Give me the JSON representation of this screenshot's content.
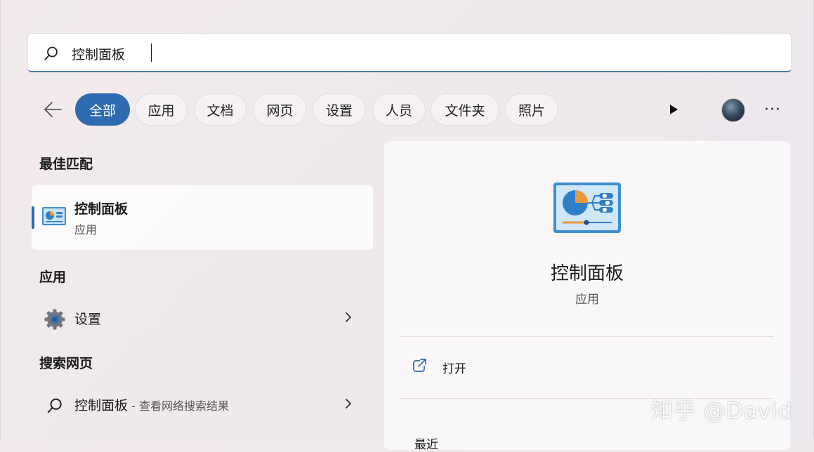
{
  "search": {
    "value": "控制面板",
    "icon": "search-icon"
  },
  "filters": {
    "back_icon": "arrow-left-icon",
    "chips": [
      {
        "label": "全部",
        "active": true
      },
      {
        "label": "应用",
        "active": false
      },
      {
        "label": "文档",
        "active": false
      },
      {
        "label": "网页",
        "active": false
      },
      {
        "label": "设置",
        "active": false
      },
      {
        "label": "人员",
        "active": false
      },
      {
        "label": "文件夹",
        "active": false
      },
      {
        "label": "照片",
        "active": false
      }
    ],
    "play_icon": "play-icon",
    "more_label": "···"
  },
  "results": {
    "best_match_title": "最佳匹配",
    "best_match": {
      "title": "控制面板",
      "subtitle": "应用",
      "icon": "control-panel-icon"
    },
    "apps_title": "应用",
    "apps": [
      {
        "label": "设置",
        "icon": "gear-icon"
      }
    ],
    "web_title": "搜索网页",
    "web": [
      {
        "label": "控制面板",
        "hint": " - 查看网络搜索结果",
        "icon": "search-icon"
      }
    ]
  },
  "preview": {
    "title": "控制面板",
    "subtitle": "应用",
    "open_label": "打开",
    "recent_label": "最近"
  },
  "watermark": "知乎 @David",
  "colors": {
    "accent": "#2e6bb0",
    "background": "#f1eaec"
  }
}
